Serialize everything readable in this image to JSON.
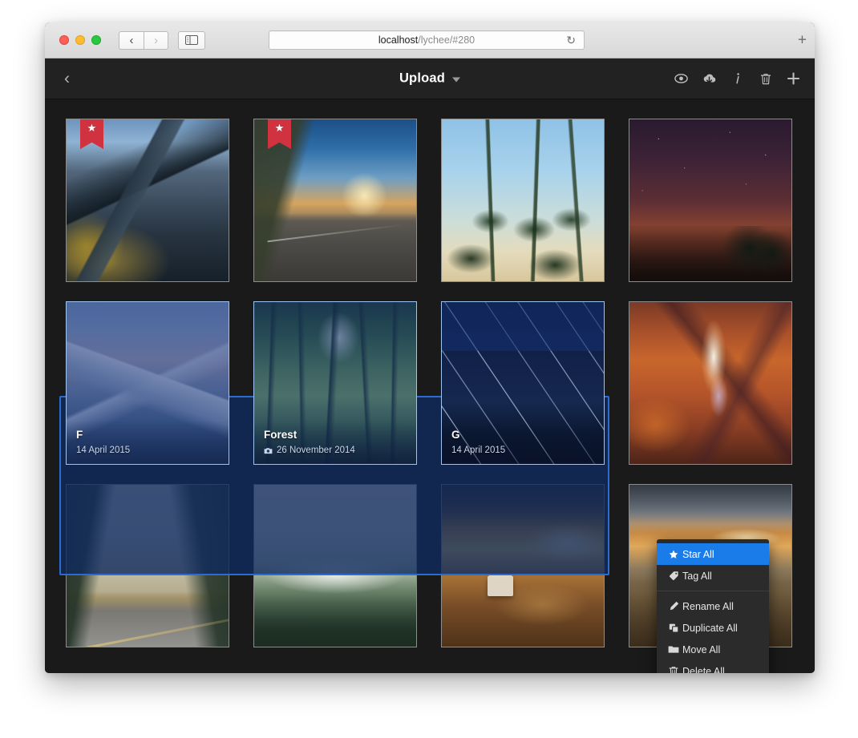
{
  "browser": {
    "url_primary": "localhost",
    "url_secondary": "/lychee/#280",
    "back_glyph": "‹",
    "forward_glyph": "›",
    "reload_glyph": "↻",
    "new_tab_glyph": "+"
  },
  "app": {
    "back_glyph": "‹",
    "album_title": "Upload",
    "tools": [
      {
        "name": "visibility-icon",
        "label": "Visibility"
      },
      {
        "name": "share-icon",
        "label": "Share"
      },
      {
        "name": "info-icon",
        "label": "About"
      },
      {
        "name": "trash-icon",
        "label": "Delete"
      },
      {
        "name": "add-icon",
        "label": "Add"
      }
    ]
  },
  "photos": [
    {
      "id": "p1",
      "art": "art-mountain-waterfall",
      "starred": true,
      "selected": false,
      "title": "",
      "date": "",
      "has_camera_icon": false
    },
    {
      "id": "p2",
      "art": "art-road-sunset",
      "starred": true,
      "selected": false,
      "title": "",
      "date": "",
      "has_camera_icon": false
    },
    {
      "id": "p3",
      "art": "art-palms",
      "starred": false,
      "selected": false,
      "title": "",
      "date": "",
      "has_camera_icon": false
    },
    {
      "id": "p4",
      "art": "art-night-sky",
      "starred": false,
      "selected": false,
      "title": "",
      "date": "",
      "has_camera_icon": false
    },
    {
      "id": "p5",
      "art": "art-snow-peak",
      "starred": false,
      "selected": true,
      "title": "F",
      "date": "14 April 2015",
      "has_camera_icon": false
    },
    {
      "id": "p6",
      "art": "art-bamboo",
      "starred": false,
      "selected": true,
      "title": "Forest",
      "date": "26 November 2014",
      "has_camera_icon": true
    },
    {
      "id": "p7",
      "art": "art-startrails",
      "starred": false,
      "selected": true,
      "title": "G",
      "date": "14 April 2015",
      "has_camera_icon": false
    },
    {
      "id": "p8",
      "art": "art-canyon",
      "starred": false,
      "selected": false,
      "title": "",
      "date": "",
      "has_camera_icon": false
    },
    {
      "id": "p9",
      "art": "art-forest-road",
      "starred": false,
      "selected": false,
      "title": "",
      "date": "",
      "has_camera_icon": false
    },
    {
      "id": "p10",
      "art": "art-foggy-forest",
      "starred": false,
      "selected": false,
      "title": "",
      "date": "",
      "has_camera_icon": false
    },
    {
      "id": "p11",
      "art": "art-van-dust",
      "starred": false,
      "selected": false,
      "title": "",
      "date": "",
      "has_camera_icon": false
    },
    {
      "id": "p12",
      "art": "art-lake-dusk",
      "starred": false,
      "selected": false,
      "title": "",
      "date": "",
      "has_camera_icon": false
    }
  ],
  "context_menu": {
    "items": [
      {
        "icon": "star-icon",
        "label": "Star All",
        "highlighted": true,
        "separator_after": false
      },
      {
        "icon": "tag-icon",
        "label": "Tag All",
        "highlighted": false,
        "separator_after": true
      },
      {
        "icon": "pencil-icon",
        "label": "Rename All",
        "highlighted": false,
        "separator_after": false
      },
      {
        "icon": "duplicate-icon",
        "label": "Duplicate All",
        "highlighted": false,
        "separator_after": false
      },
      {
        "icon": "folder-icon",
        "label": "Move All",
        "highlighted": false,
        "separator_after": false
      },
      {
        "icon": "trash-icon",
        "label": "Delete All",
        "highlighted": false,
        "separator_after": false
      }
    ]
  },
  "colors": {
    "accent_blue": "#1a7ce8",
    "selection_border": "#2c6cd0",
    "star_badge_red": "#d0323f",
    "app_background": "#1a1a1a",
    "header_background": "#222222",
    "menu_background": "#2b2b2b"
  }
}
